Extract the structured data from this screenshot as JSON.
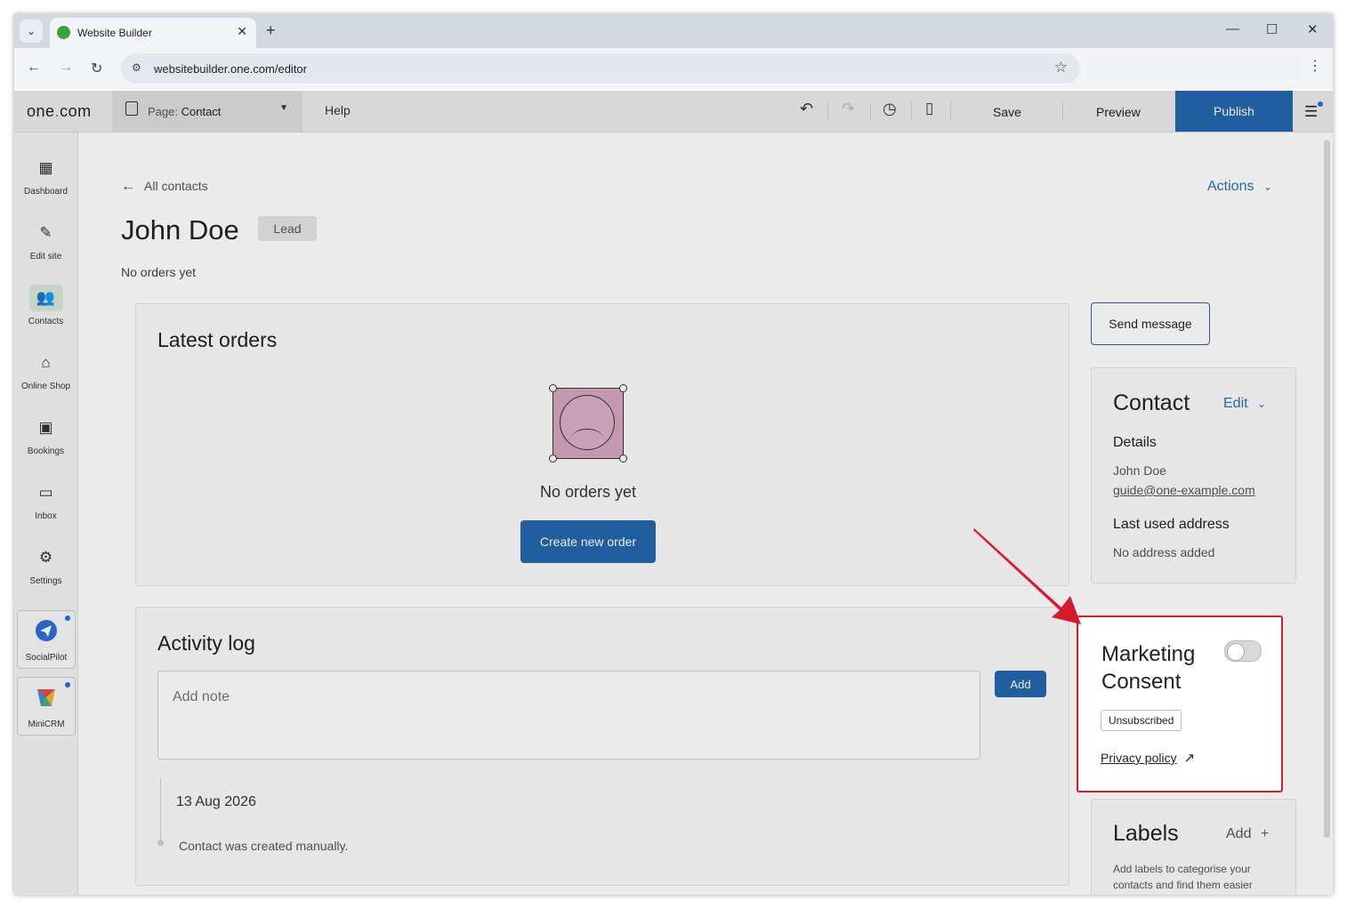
{
  "browser": {
    "tab_title": "Website Builder",
    "url": "websitebuilder.one.com/editor"
  },
  "app": {
    "logo_left": "one",
    "logo_dot": ".",
    "logo_right": "com",
    "page_prefix": "Page:",
    "page_name": "Contact",
    "help": "Help",
    "save": "Save",
    "preview": "Preview",
    "publish": "Publish",
    "accent_color": "#2466ad"
  },
  "sidebar": {
    "items": [
      {
        "label": "Dashboard",
        "icon": "dashboard-icon"
      },
      {
        "label": "Edit site",
        "icon": "edit-site-icon"
      },
      {
        "label": "Contacts",
        "icon": "contacts-icon"
      },
      {
        "label": "Online Shop",
        "icon": "shop-icon"
      },
      {
        "label": "Bookings",
        "icon": "calendar-icon"
      },
      {
        "label": "Inbox",
        "icon": "inbox-icon"
      },
      {
        "label": "Settings",
        "icon": "gear-icon"
      }
    ],
    "apps": [
      {
        "label": "SocialPilot",
        "icon": "socialpilot-icon"
      },
      {
        "label": "MiniCRM",
        "icon": "minicrm-icon"
      }
    ]
  },
  "contact": {
    "back_label": "All contacts",
    "actions_label": "Actions",
    "name": "John Doe",
    "badge": "Lead",
    "orders_summary": "No orders yet"
  },
  "orders": {
    "title": "Latest orders",
    "empty_text": "No orders yet",
    "create_button": "Create new order"
  },
  "activity": {
    "title": "Activity log",
    "note_placeholder": "Add note",
    "add_button": "Add",
    "entries": [
      {
        "date": "13 Aug 2026",
        "text": "Contact was created manually."
      }
    ]
  },
  "side": {
    "send_message": "Send message",
    "contact_title": "Contact",
    "edit_label": "Edit",
    "details_heading": "Details",
    "details_name": "John Doe",
    "details_email": "guide@one-example.com",
    "address_heading": "Last used address",
    "address_value": "No address added",
    "consent_title_1": "Marketing",
    "consent_title_2": "Consent",
    "consent_enabled": false,
    "consent_status": "Unsubscribed",
    "privacy_link": "Privacy policy",
    "labels_title": "Labels",
    "labels_add": "Add",
    "labels_hint_1": "Add labels to categorise your",
    "labels_hint_2": "contacts and find them easier"
  },
  "highlight_color": "#d9192c"
}
